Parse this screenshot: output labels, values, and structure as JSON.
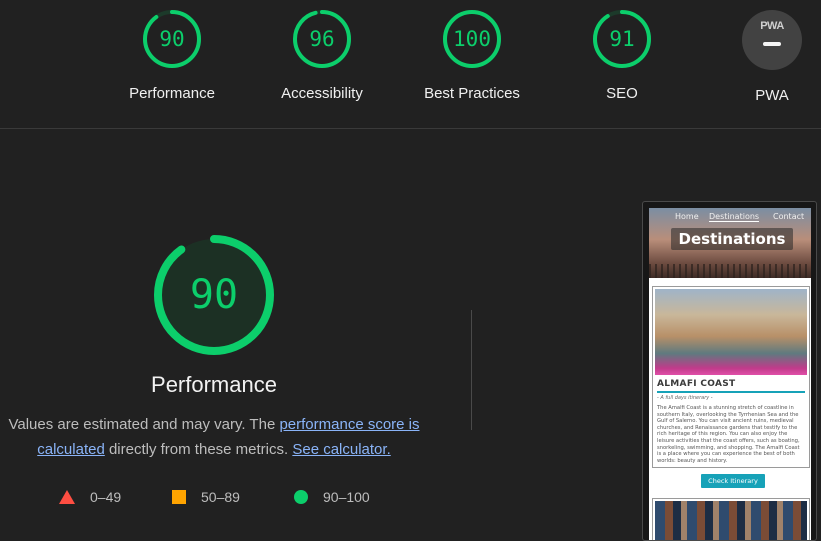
{
  "categories": [
    {
      "score": "90",
      "label": "Performance",
      "fraction": 0.9
    },
    {
      "score": "96",
      "label": "Accessibility",
      "fraction": 0.96
    },
    {
      "score": "100",
      "label": "Best Practices",
      "fraction": 1.0
    },
    {
      "score": "91",
      "label": "SEO",
      "fraction": 0.91
    }
  ],
  "pwa": {
    "badge": "PWA",
    "label": "PWA"
  },
  "main": {
    "score": "90",
    "fraction": 0.9,
    "title": "Performance",
    "desc_prefix": "Values are estimated and may vary. The ",
    "link1": "performance score is calculated",
    "desc_middle": " directly from these metrics. ",
    "link2": "See calculator."
  },
  "legend": [
    {
      "range": "0–49"
    },
    {
      "range": "50–89"
    },
    {
      "range": "90–100"
    }
  ],
  "colors": {
    "pass": "#0cce6b",
    "average": "#ffa400",
    "fail": "#ff4e42",
    "background": "#212121"
  },
  "screenshot": {
    "nav": [
      "Home",
      "Destinations",
      "Contact"
    ],
    "hero_title": "Destinations",
    "card_title": "ALMAFI COAST",
    "card_subtitle": "- A full days itinerary -",
    "card_body": "The Amalfi Coast is a stunning stretch of coastline in southern Italy, overlooking the Tyrrhenian Sea and the Gulf of Salerno. You can visit ancient ruins, medieval churches, and Renaissance gardens that testify to the rich heritage of this region. You can also enjoy the leisure activities that the coast offers, such as boating, snorkeling, swimming, and shopping. The Amalfi Coast is a place where you can experience the best of both worlds: beauty and history.",
    "card_button": "Check Itinerary"
  }
}
